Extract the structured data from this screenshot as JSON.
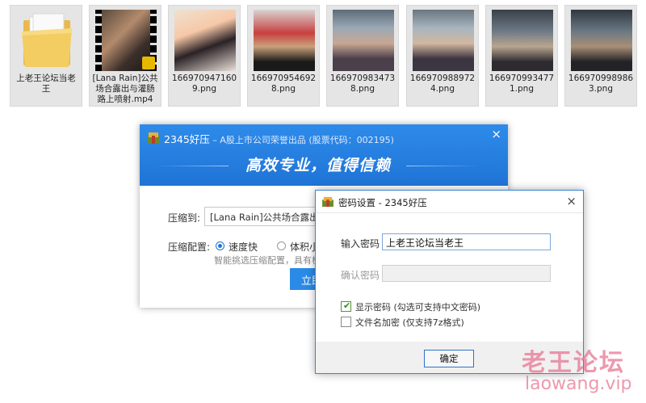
{
  "files": [
    {
      "name": "上老王论坛当老王",
      "kind": "folder"
    },
    {
      "name": "[Lana Rain]公共场合露出与灌肠路上喷射.mp4",
      "kind": "video"
    },
    {
      "name": "1669709471609.png",
      "kind": "image"
    },
    {
      "name": "1669709546928.png",
      "kind": "image"
    },
    {
      "name": "1669709834738.png",
      "kind": "image"
    },
    {
      "name": "1669709889724.png",
      "kind": "image"
    },
    {
      "name": "1669709934771.png",
      "kind": "image"
    },
    {
      "name": "1669709989863.png",
      "kind": "image"
    }
  ],
  "main_window": {
    "title": "2345好压",
    "subtitle": " – A股上市公司荣誉出品 (股票代码：002195)",
    "close": "×",
    "slogan": "高效专业，值得信赖",
    "compress_to_label": "压缩到:",
    "compress_to_value": "[Lana Rain]公共场合露出与灌",
    "config_label": "压缩配置:",
    "option_fast": "速度快",
    "option_small": "体积小",
    "hint": "智能挑选压缩配置，具有极佳",
    "start_button": "立即"
  },
  "password_dialog": {
    "title": "密码设置 - 2345好压",
    "close": "×",
    "enter_label": "输入密码",
    "enter_value": "上老王论坛当老王",
    "confirm_label": "确认密码",
    "confirm_value": "",
    "show_password_label": "显示密码 (勾选可支持中文密码)",
    "show_password_checked": true,
    "encrypt_names_label": "文件名加密 (仅支持7z格式)",
    "encrypt_names_checked": false,
    "ok_button": "确定"
  },
  "watermark": {
    "line1": "老王论坛",
    "line2": "laowang.vip"
  },
  "colors": {
    "accent": "#1f74d6",
    "header_blue": "#2e8bea",
    "watermark": "#e77691"
  }
}
